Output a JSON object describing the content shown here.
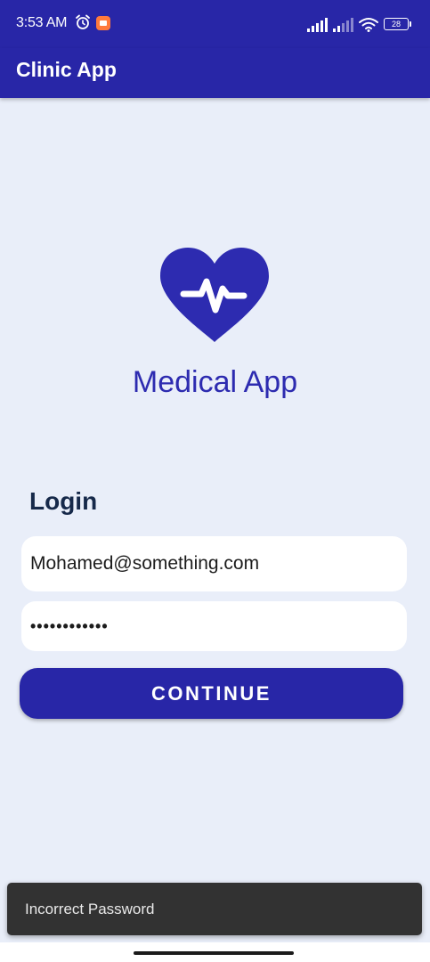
{
  "status_bar": {
    "time": "3:53 AM",
    "battery": "28",
    "icons": [
      "alarm-icon",
      "screen-record-icon",
      "signal-icon",
      "signal-icon",
      "wifi-icon",
      "battery-icon"
    ]
  },
  "app_bar": {
    "title": "Clinic App"
  },
  "logo": {
    "icon": "heart-pulse-icon",
    "brand_name": "Medical App"
  },
  "login": {
    "heading": "Login",
    "email_value": "Mohamed@something.com",
    "password_value": "••••••••••••",
    "continue_label": "CONTINUE"
  },
  "snackbar": {
    "message": "Incorrect Password"
  },
  "colors": {
    "primary": "#2826a7",
    "background": "#e9eef9",
    "brand_text": "#2d2bb0",
    "heading_text": "#16294a",
    "snackbar_bg": "#323232"
  }
}
